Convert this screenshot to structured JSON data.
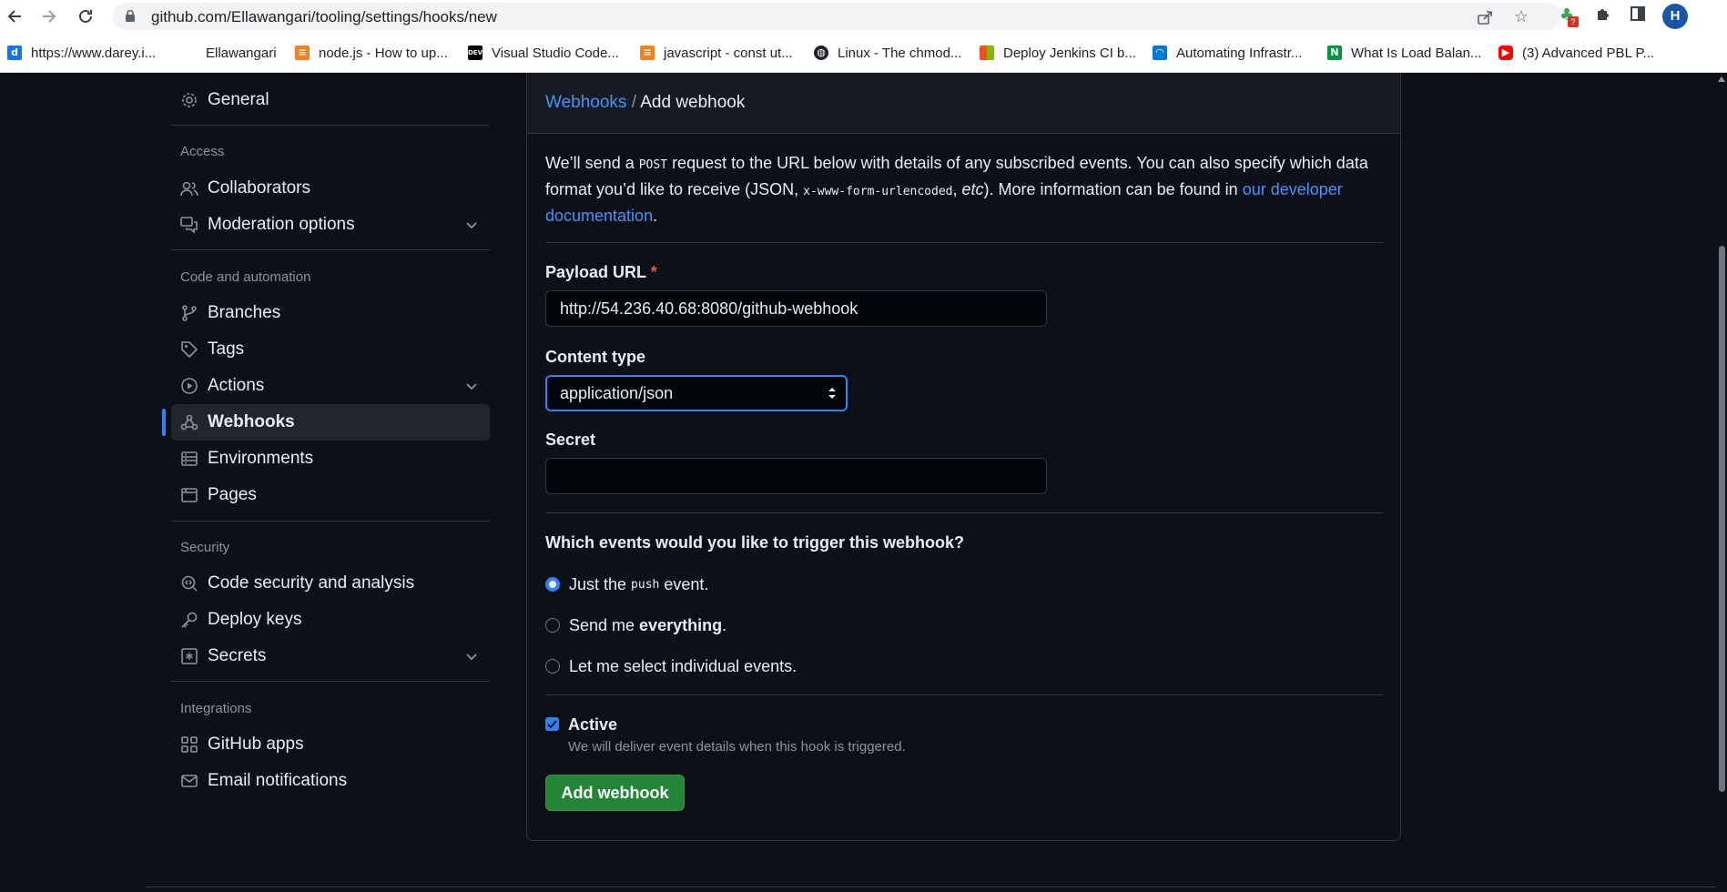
{
  "browser": {
    "url": "github.com/Ellawangari/tooling/settings/hooks/new",
    "profile_initial": "H",
    "extension_badge": "?",
    "bookmarks": [
      {
        "label": "https://www.darey.i...",
        "icon": "darey-icon",
        "color": "#1a73e8"
      },
      {
        "label": "Ellawangari",
        "icon": "blank-icon",
        "color": "#ffffff"
      },
      {
        "label": "node.js - How to up...",
        "icon": "stackoverflow-icon",
        "color": "#f48024"
      },
      {
        "label": "Visual Studio Code...",
        "icon": "dev-icon",
        "color": "#000000"
      },
      {
        "label": "javascript - const ut...",
        "icon": "stackoverflow-icon",
        "color": "#f48024"
      },
      {
        "label": "Linux - The chmod...",
        "icon": "globe-icon",
        "color": "#202124"
      },
      {
        "label": "Deploy Jenkins CI b...",
        "icon": "microsoft-icon",
        "color": "#f25022"
      },
      {
        "label": "Automating Infrastr...",
        "icon": "azure-devops-icon",
        "color": "#0078d4"
      },
      {
        "label": "What Is Load Balan...",
        "icon": "nginx-icon",
        "color": "#009639"
      },
      {
        "label": "(3) Advanced PBL P...",
        "icon": "youtube-icon",
        "color": "#ff0000"
      }
    ]
  },
  "sidebar": {
    "general": "General",
    "headings": {
      "access": "Access",
      "code_automation": "Code and automation",
      "security": "Security",
      "integrations": "Integrations"
    },
    "items": {
      "collaborators": "Collaborators",
      "moderation": "Moderation options",
      "branches": "Branches",
      "tags": "Tags",
      "actions": "Actions",
      "webhooks": "Webhooks",
      "environments": "Environments",
      "pages": "Pages",
      "code_security": "Code security and analysis",
      "deploy_keys": "Deploy keys",
      "secrets": "Secrets",
      "github_apps": "GitHub apps",
      "email_notifications": "Email notifications"
    },
    "active": "webhooks"
  },
  "main": {
    "breadcrumb": {
      "parent": "Webhooks",
      "separator": "/",
      "current": "Add webhook"
    },
    "intro": {
      "part1": "We’ll send a",
      "post": "POST",
      "part2": "request to the URL below with details of any subscribed events. You can also specify which data format you’d like to receive (JSON,",
      "urlencoded": "x-www-form-urlencoded",
      "etc": "etc",
      "part3": "). More information can be found in",
      "link": "our developer documentation",
      "end": "."
    },
    "payload_url": {
      "label": "Payload URL",
      "required_mark": "*",
      "value": "http://54.236.40.68:8080/github-webhook"
    },
    "content_type": {
      "label": "Content type",
      "value": "application/json"
    },
    "secret": {
      "label": "Secret",
      "value": ""
    },
    "events": {
      "question": "Which events would you like to trigger this webhook?",
      "options": [
        {
          "prefix": "Just the",
          "code": "push",
          "suffix": "event.",
          "checked": true
        },
        {
          "prefix": "Send me",
          "bold": "everything",
          "suffix": ".",
          "checked": false
        },
        {
          "prefix": "Let me select individual events.",
          "checked": false
        }
      ]
    },
    "active": {
      "label": "Active",
      "checked": true,
      "note": "We will deliver event details when this hook is triggered."
    },
    "submit": "Add webhook"
  },
  "colors": {
    "background": "#0d1117",
    "link": "#4493f8",
    "primary_button": "#238636",
    "active_indicator": "#2f81f7",
    "required": "#f85149"
  }
}
